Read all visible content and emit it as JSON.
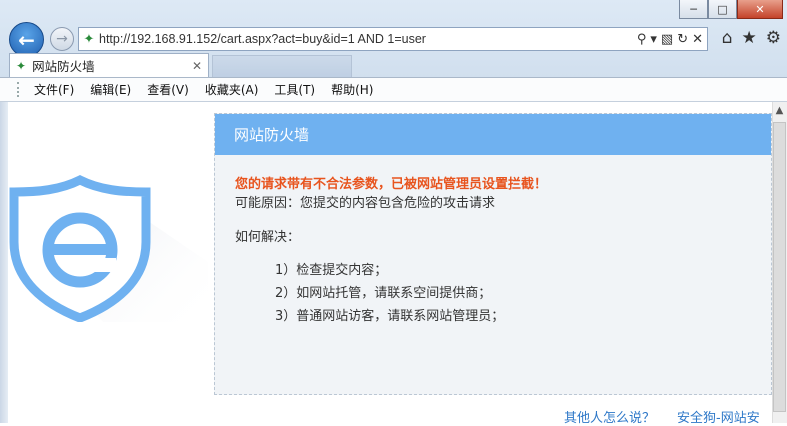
{
  "browser": {
    "url": "http://192.168.91.152/cart.aspx?act=buy&id=1 AND 1=user",
    "tab_title": "网站防火墙",
    "menu": [
      "文件(F)",
      "编辑(E)",
      "查看(V)",
      "收藏夹(A)",
      "工具(T)",
      "帮助(H)"
    ]
  },
  "page": {
    "panel_title": "网站防火墙",
    "warning": "您的请求带有不合法参数，已被网站管理员设置拦截！",
    "reason": "可能原因：您提交的内容包含危险的攻击请求",
    "how_title": "如何解决：",
    "solutions": [
      "1）检查提交内容；",
      "2）如网站托管，请联系空间提供商；",
      "3）普通网站访客，请联系网站管理员；"
    ],
    "footer_links": [
      "其他人怎么说？",
      "安全狗-网站安"
    ]
  },
  "colors": {
    "header_blue": "#6fb1f0",
    "warning_orange": "#e8541e",
    "link_blue": "#2e78c8"
  }
}
